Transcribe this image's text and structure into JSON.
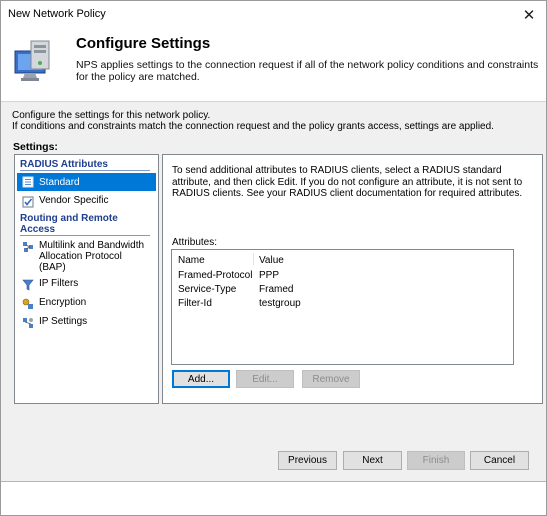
{
  "window": {
    "title": "New Network Policy"
  },
  "header": {
    "title": "Configure Settings",
    "description": "NPS applies settings to the connection request if all of the network policy conditions and constraints for the policy are matched."
  },
  "intro": {
    "line1": "Configure the settings for this network policy.",
    "line2": "If conditions and constraints match the connection request and the policy grants access, settings are applied."
  },
  "settings_label": "Settings:",
  "nav": {
    "radius_header": "RADIUS Attributes",
    "standard": "Standard",
    "vendor_specific": "Vendor Specific",
    "routing_header": "Routing and Remote Access",
    "multilink": "Multilink and Bandwidth Allocation Protocol (BAP)",
    "ip_filters": "IP Filters",
    "encryption": "Encryption",
    "ip_settings": "IP Settings"
  },
  "panel": {
    "description": "To send additional attributes to RADIUS clients, select a RADIUS standard attribute, and then click Edit. If you do not configure an attribute, it is not sent to RADIUS clients. See your RADIUS client documentation for required attributes.",
    "attributes_label": "Attributes:",
    "columns": {
      "name": "Name",
      "value": "Value"
    },
    "rows": [
      {
        "name": "Framed-Protocol",
        "value": "PPP"
      },
      {
        "name": "Service-Type",
        "value": "Framed"
      },
      {
        "name": "Filter-Id",
        "value": "testgroup"
      }
    ],
    "buttons": {
      "add": "Add...",
      "edit": "Edit...",
      "remove": "Remove"
    }
  },
  "footer": {
    "previous": "Previous",
    "next": "Next",
    "finish": "Finish",
    "cancel": "Cancel"
  },
  "colors": {
    "selection": "#0078d7",
    "section_header": "#1f3e8f"
  }
}
